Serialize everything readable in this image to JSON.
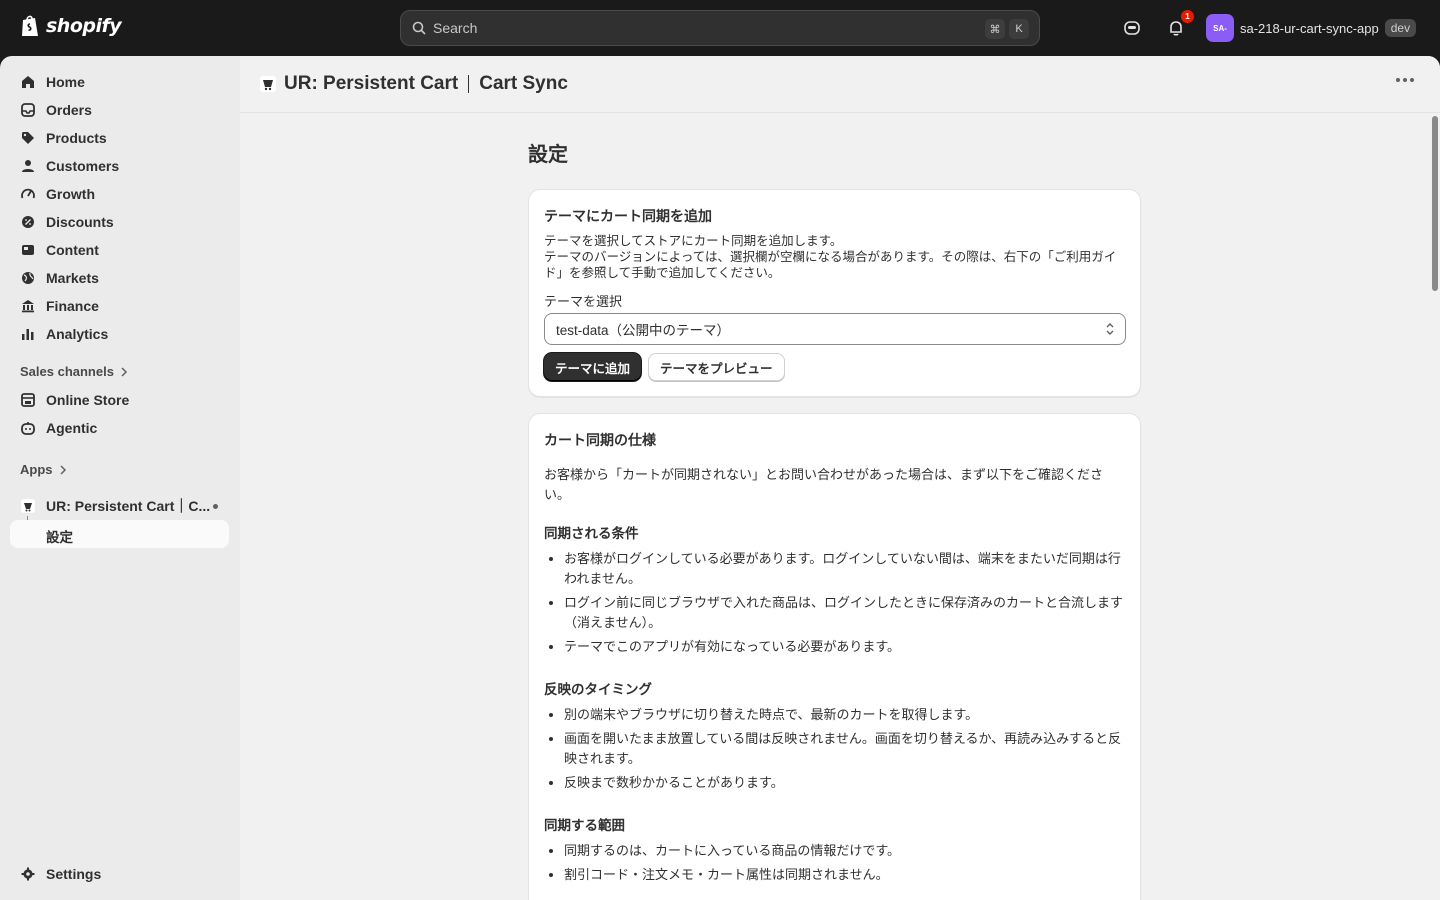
{
  "topbar": {
    "logo_text": "shopify",
    "search_placeholder": "Search",
    "shortcut_cmd": "⌘",
    "shortcut_key": "K",
    "notification_count": "1",
    "store_initials": "SA-",
    "store_name": "sa-218-ur-cart-sync-app",
    "env_tag": "dev"
  },
  "sidebar": {
    "items": [
      {
        "label": "Home",
        "icon": "home-icon"
      },
      {
        "label": "Orders",
        "icon": "orders-icon"
      },
      {
        "label": "Products",
        "icon": "tag-icon"
      },
      {
        "label": "Customers",
        "icon": "person-icon"
      },
      {
        "label": "Growth",
        "icon": "gauge-icon"
      },
      {
        "label": "Discounts",
        "icon": "discount-icon"
      },
      {
        "label": "Content",
        "icon": "content-icon"
      },
      {
        "label": "Markets",
        "icon": "globe-icon"
      },
      {
        "label": "Finance",
        "icon": "bank-icon"
      },
      {
        "label": "Analytics",
        "icon": "bar-chart-icon"
      }
    ],
    "sales_channels_label": "Sales channels",
    "channels": [
      {
        "label": "Online Store",
        "icon": "store-icon"
      },
      {
        "label": "Agentic",
        "icon": "agent-icon"
      }
    ],
    "apps_label": "Apps",
    "app_item_label": "UR: Persistent Cart｜C...",
    "app_sub_label": "設定",
    "settings_label": "Settings"
  },
  "header": {
    "app_name": "UR: Persistent Cart",
    "app_subtitle": "Cart Sync"
  },
  "page": {
    "title": "設定"
  },
  "card1": {
    "heading": "テーマにカート同期を追加",
    "desc_line1": "テーマを選択してストアにカート同期を追加します。",
    "desc_line2": "テーマのバージョンによっては、選択欄が空欄になる場合があります。その際は、右下の「ご利用ガイド」を参照して手動で追加してください。",
    "select_label": "テーマを選択",
    "select_value": "test-data（公開中のテーマ）",
    "primary_button": "テーマに追加",
    "secondary_button": "テーマをプレビュー"
  },
  "card2": {
    "heading": "カート同期の仕様",
    "intro": "お客様から「カートが同期されない」とお問い合わせがあった場合は、まず以下をご確認ください。",
    "sections": [
      {
        "title": "同期される条件",
        "bullets": [
          "お客様がログインしている必要があります。ログインしていない間は、端末をまたいだ同期は行われません。",
          "ログイン前に同じブラウザで入れた商品は、ログインしたときに保存済みのカートと合流します（消えません）。",
          "テーマでこのアプリが有効になっている必要があります。"
        ]
      },
      {
        "title": "反映のタイミング",
        "bullets": [
          "別の端末やブラウザに切り替えた時点で、最新のカートを取得します。",
          "画面を開いたまま放置している間は反映されません。画面を切り替えるか、再読み込みすると反映されます。",
          "反映まで数秒かかることがあります。"
        ]
      },
      {
        "title": "同期する範囲",
        "bullets": [
          "同期するのは、カートに入っている商品の情報だけです。",
          "割引コード・注文メモ・カート属性は同期されません。"
        ]
      }
    ]
  },
  "colors": {
    "topbar_bg": "#1a1a1a",
    "sidebar_bg": "#ebebeb",
    "main_bg": "#f1f1f1",
    "primary_button_bg": "#303030",
    "avatar_bg": "#8b5cf6",
    "badge_bg": "#e51c00"
  }
}
